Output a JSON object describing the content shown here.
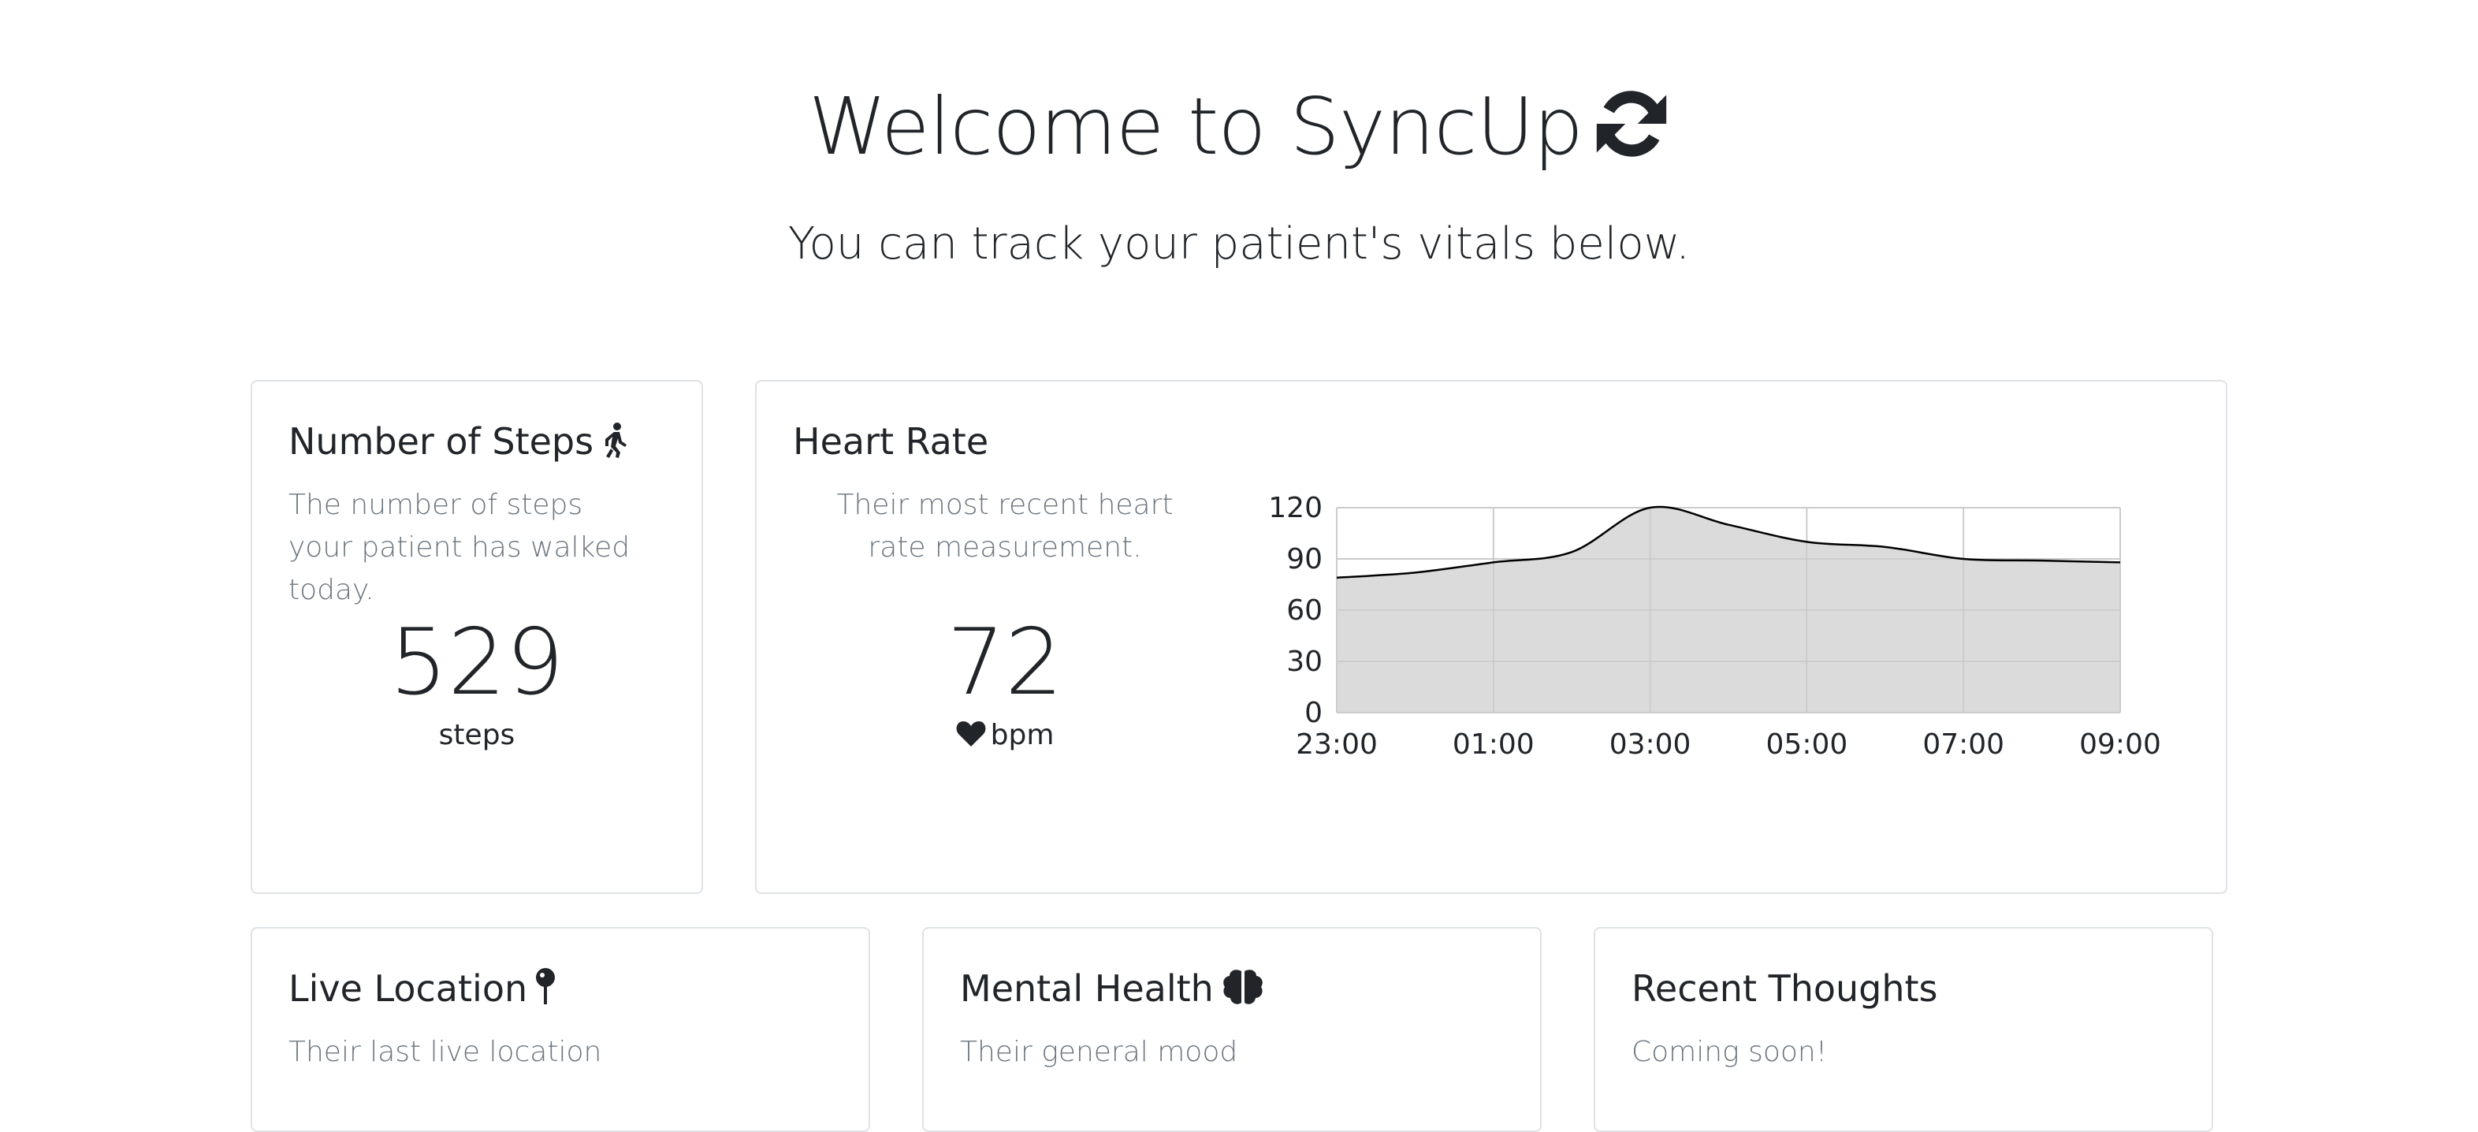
{
  "header": {
    "title": "Welcome to SyncUp",
    "subtitle": "You can track your patient's vitals below."
  },
  "steps_card": {
    "title": "Number of Steps",
    "description": "The number of steps your patient has walked today.",
    "value": "529",
    "unit": "steps",
    "icon": "walking-icon"
  },
  "heart_card": {
    "title": "Heart Rate",
    "description": "Their most recent heart rate measurement.",
    "value": "72",
    "unit": "bpm",
    "icon": "heart-icon"
  },
  "location_card": {
    "title": "Live Location",
    "description": "Their last live location",
    "icon": "map-pin-icon"
  },
  "mental_card": {
    "title": "Mental Health",
    "description": "Their general mood",
    "icon": "brain-icon"
  },
  "thoughts_card": {
    "title": "Recent Thoughts",
    "description": "Coming soon!"
  },
  "chart_data": {
    "type": "area",
    "x": [
      "23:00",
      "00:00",
      "01:00",
      "02:00",
      "03:00",
      "04:00",
      "05:00",
      "06:00",
      "07:00",
      "08:00",
      "09:00"
    ],
    "values": [
      79,
      82,
      88,
      94,
      120,
      110,
      100,
      97,
      90,
      89,
      88
    ],
    "xticks": [
      "23:00",
      "01:00",
      "03:00",
      "05:00",
      "07:00",
      "09:00"
    ],
    "yticks": [
      0,
      30,
      60,
      90,
      120
    ],
    "ylim": [
      0,
      120
    ],
    "grid": true,
    "fill_color": "#d9d9d9",
    "line_color": "#000000"
  }
}
